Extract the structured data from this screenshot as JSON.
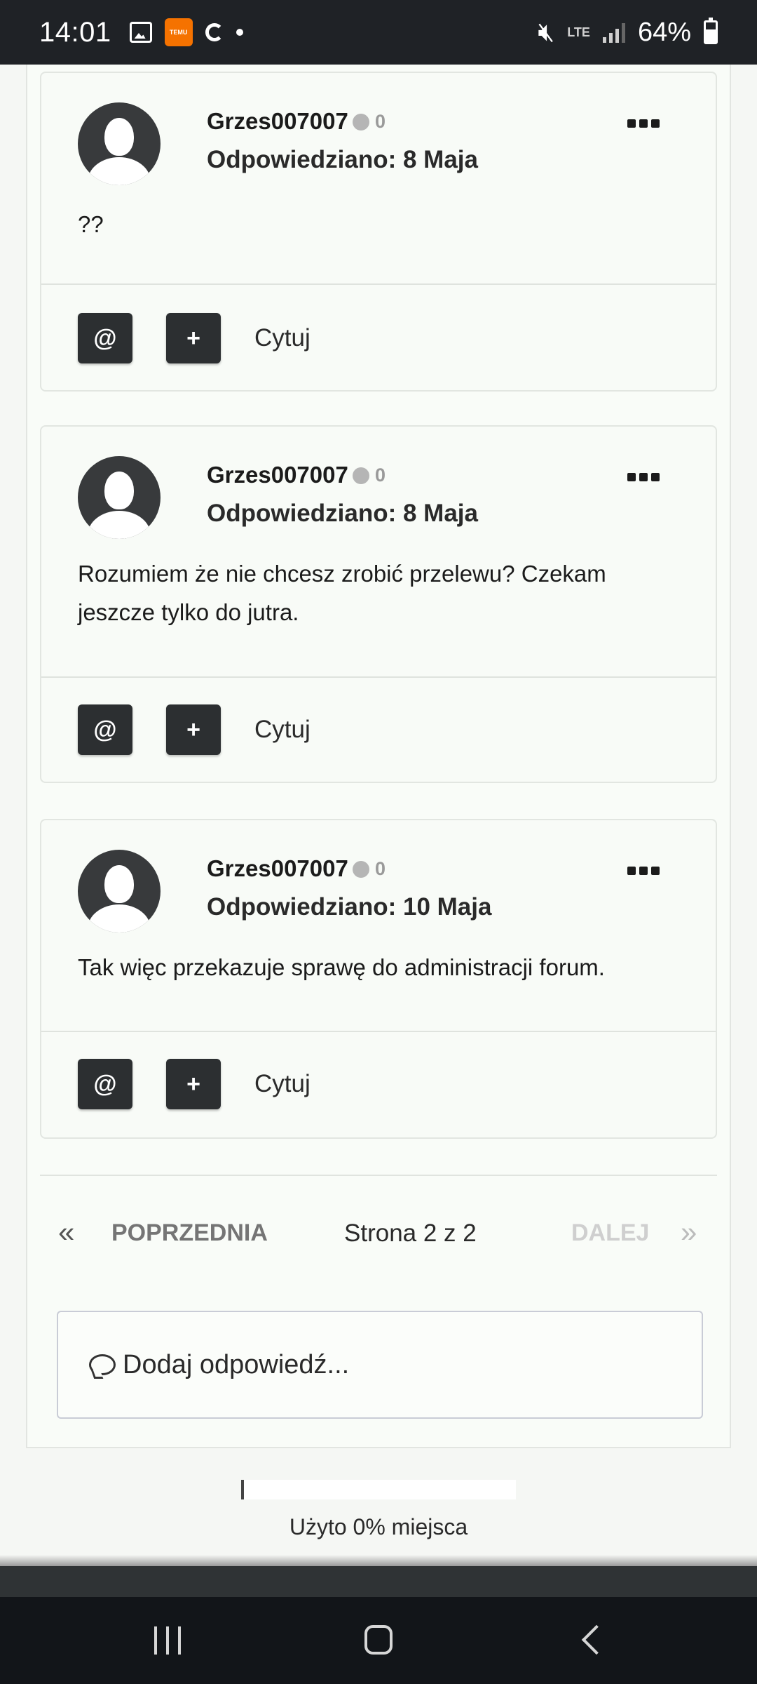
{
  "status_bar": {
    "time": "14:01",
    "temu_label": "TEMU",
    "network": "LTE",
    "battery": "64%"
  },
  "posts": [
    {
      "username": "Grzes007007",
      "reputation": "0",
      "date": "Odpowiedziano: 8 Maja",
      "content": "??",
      "mention_label": "@",
      "plus_label": "+",
      "quote_label": "Cytuj"
    },
    {
      "username": "Grzes007007",
      "reputation": "0",
      "date": "Odpowiedziano: 8 Maja",
      "content": "Rozumiem że nie chcesz zrobić przelewu? Czekam jeszcze tylko do jutra.",
      "mention_label": "@",
      "plus_label": "+",
      "quote_label": "Cytuj"
    },
    {
      "username": "Grzes007007",
      "reputation": "0",
      "date": "Odpowiedziano: 10 Maja",
      "content": "Tak więc przekazuje sprawę do administracji forum.",
      "mention_label": "@",
      "plus_label": "+",
      "quote_label": "Cytuj"
    }
  ],
  "pagination": {
    "prev_arrow": "«",
    "prev_label": "POPRZEDNIA",
    "page_info": "Strona 2 z 2",
    "next_label": "DALEJ",
    "next_arrow": "»"
  },
  "reply": {
    "placeholder": "Dodaj odpowiedź..."
  },
  "quota": {
    "used_fraction": 0.0,
    "label": "Użyto 0% miejsca"
  },
  "colors": {
    "button_dark": "#2c2f31",
    "status_bar": "#1f2226",
    "nav_bar": "#121519",
    "temu_orange": "#f57200"
  }
}
